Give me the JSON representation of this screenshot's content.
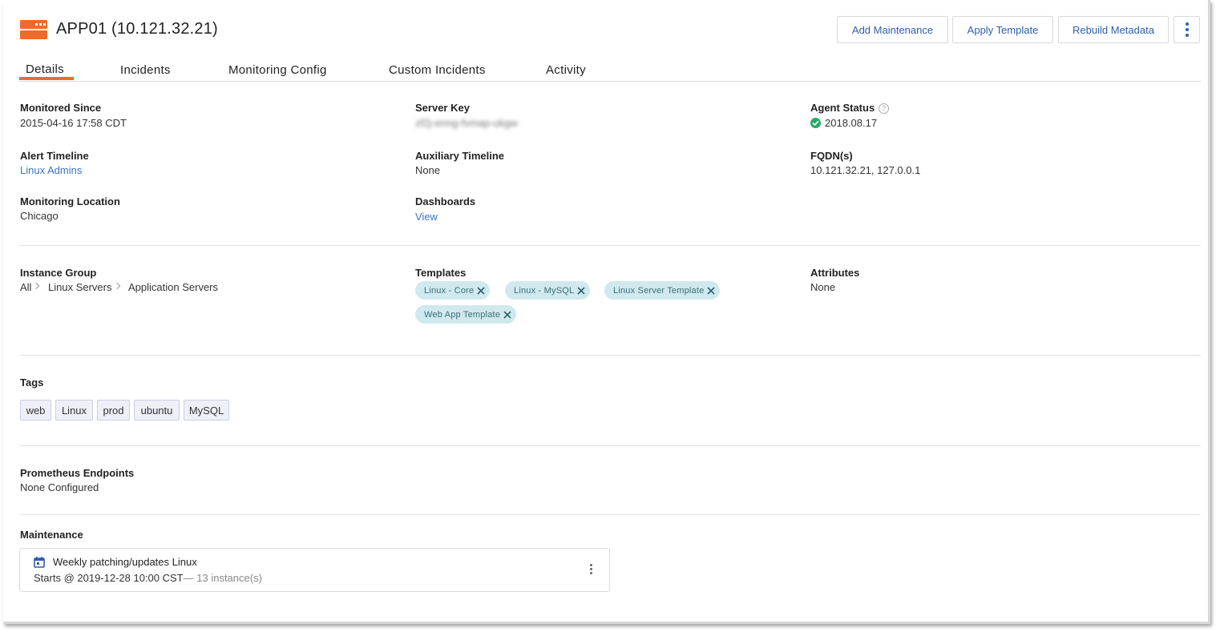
{
  "header": {
    "title": "APP01 (10.121.32.21)",
    "icon": "server-icon",
    "accent_color": "#f26a2a",
    "buttons": {
      "add_maintenance": "Add Maintenance",
      "apply_template": "Apply Template",
      "rebuild_metadata": "Rebuild Metadata"
    }
  },
  "tabs": [
    {
      "label": "Details",
      "active": true
    },
    {
      "label": "Incidents"
    },
    {
      "label": "Monitoring Config"
    },
    {
      "label": "Custom Incidents"
    },
    {
      "label": "Activity"
    }
  ],
  "details": {
    "monitored_since": {
      "label": "Monitored Since",
      "value": "2015-04-16 17:58 CDT"
    },
    "server_key": {
      "label": "Server Key",
      "value": "zf2j-enng-fvmap-ukgw"
    },
    "agent_status": {
      "label": "Agent Status",
      "value": "2018.08.17",
      "status_color": "#2aa86a"
    },
    "alert_timeline": {
      "label": "Alert Timeline",
      "value": "Linux Admins"
    },
    "auxiliary_timeline": {
      "label": "Auxiliary Timeline",
      "value": "None"
    },
    "fqdn": {
      "label": "FQDN(s)",
      "value": "10.121.32.21, 127.0.0.1"
    },
    "monitoring_location": {
      "label": "Monitoring Location",
      "value": "Chicago"
    },
    "dashboards": {
      "label": "Dashboards",
      "value": "View"
    }
  },
  "instance_group": {
    "label": "Instance Group",
    "path": [
      "All",
      "Linux Servers",
      "Application Servers"
    ]
  },
  "templates": {
    "label": "Templates",
    "items": [
      "Linux - Core",
      "Linux - MySQL",
      "Linux Server Template",
      "Web App Template"
    ]
  },
  "attributes": {
    "label": "Attributes",
    "value": "None"
  },
  "tags": {
    "label": "Tags",
    "items": [
      "web",
      "Linux",
      "prod",
      "ubuntu",
      "MySQL"
    ]
  },
  "prometheus": {
    "label": "Prometheus Endpoints",
    "value": "None Configured"
  },
  "maintenance": {
    "label": "Maintenance",
    "items": [
      {
        "title": "Weekly patching/updates Linux",
        "starts": "Starts @ 2019-12-28 10:00 CST",
        "instances": "— 13 instance(s)"
      }
    ]
  }
}
